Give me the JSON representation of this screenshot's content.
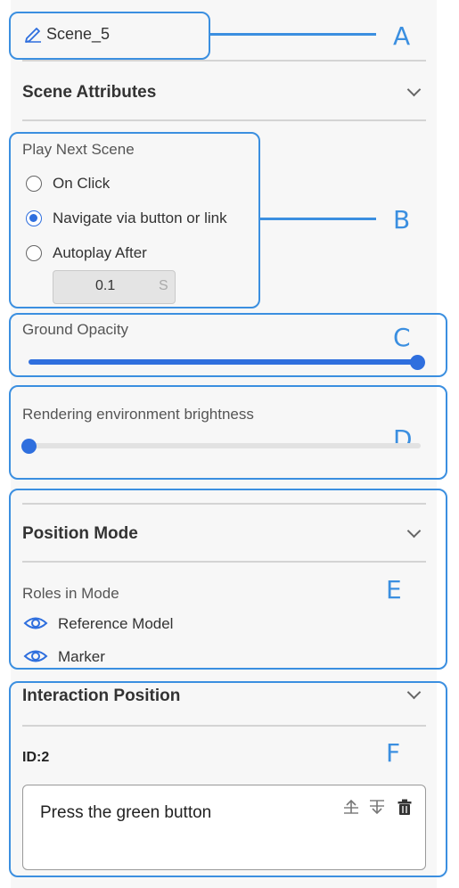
{
  "header": {
    "scene_name": "Scene_5"
  },
  "scene_attributes": {
    "title": "Scene Attributes"
  },
  "play_next": {
    "label": "Play Next Scene",
    "options": [
      "On Click",
      "Navigate via button or link",
      "Autoplay After"
    ],
    "selected": "Navigate via button or link",
    "autoplay_value": "0.1",
    "autoplay_unit": "S"
  },
  "ground_opacity": {
    "label": "Ground Opacity",
    "value": 1.0
  },
  "brightness": {
    "label": "Rendering environment brightness",
    "value": 0.0
  },
  "position_mode": {
    "title": "Position Mode",
    "roles_label": "Roles in Mode",
    "roles": [
      "Reference Model",
      "Marker"
    ]
  },
  "interaction_position": {
    "title": "Interaction Position",
    "id_label": "ID:2",
    "text": "Press the green button"
  },
  "callouts": [
    "A",
    "B",
    "C",
    "D",
    "E",
    "F"
  ],
  "colors": {
    "accent": "#2f6fde",
    "callout": "#3b8fe0",
    "panel_bg": "#f7f7f7"
  },
  "icons": [
    "pencil-icon",
    "chevron-down-icon",
    "eye-icon",
    "move-up-icon",
    "move-down-icon",
    "trash-icon"
  ]
}
